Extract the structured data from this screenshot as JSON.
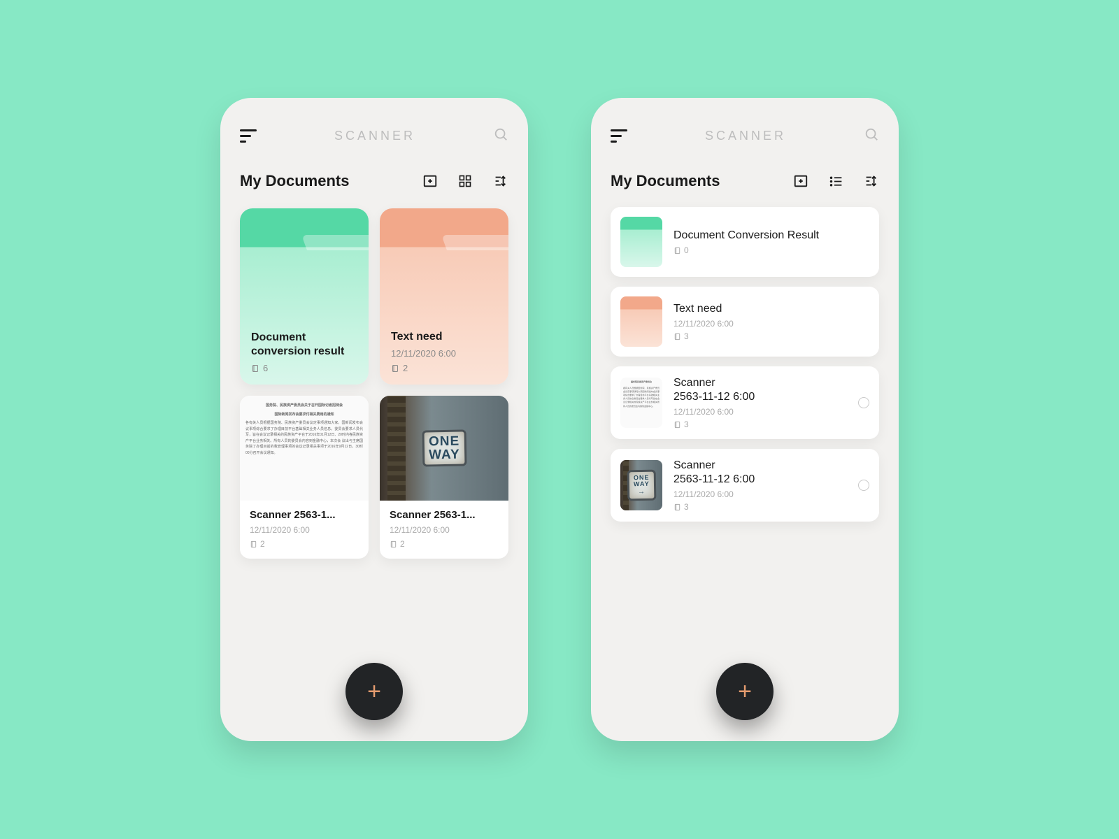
{
  "app": {
    "title": "SCANNER"
  },
  "colors": {
    "mint": "#87E8C5",
    "fabBg": "#222426",
    "fabPlus": "#E49C6F",
    "folderGreen": "#55D8A5",
    "folderOrange": "#F2A88A"
  },
  "left": {
    "sectionTitle": "My Documents",
    "items": [
      {
        "kind": "folder",
        "color": "green",
        "title": "Document conversion result",
        "count": "6"
      },
      {
        "kind": "folder",
        "color": "orange",
        "title": "Text need",
        "date": "12/11/2020 6:00",
        "count": "2"
      },
      {
        "kind": "doc",
        "thumb": "text",
        "title": "Scanner 2563-1...",
        "date": "12/11/2020 6:00",
        "count": "2"
      },
      {
        "kind": "doc",
        "thumb": "oneway",
        "title": "Scanner 2563-1...",
        "date": "12/11/2020 6:00",
        "count": "2"
      }
    ]
  },
  "right": {
    "sectionTitle": "My Documents",
    "items": [
      {
        "kind": "folder",
        "color": "green",
        "title": "Document Conversion Result",
        "count": "0"
      },
      {
        "kind": "folder",
        "color": "orange",
        "title": "Text need",
        "date": "12/11/2020 6:00",
        "count": "3"
      },
      {
        "kind": "doc",
        "thumb": "text",
        "title": "Scanner\n2563-11-12 6:00",
        "date": "12/11/2020 6:00",
        "count": "3",
        "selectable": true
      },
      {
        "kind": "doc",
        "thumb": "oneway",
        "title": "Scanner\n2563-11-12 6:00",
        "date": "12/11/2020 6:00",
        "count": "3",
        "selectable": true
      }
    ]
  },
  "icons": {
    "menu": "menu-icon",
    "search": "search-icon",
    "newfolder": "new-folder-icon",
    "grid": "grid-view-icon",
    "list": "list-view-icon",
    "sort": "sort-icon",
    "bookmark": "book-icon",
    "fab": "add-icon"
  }
}
